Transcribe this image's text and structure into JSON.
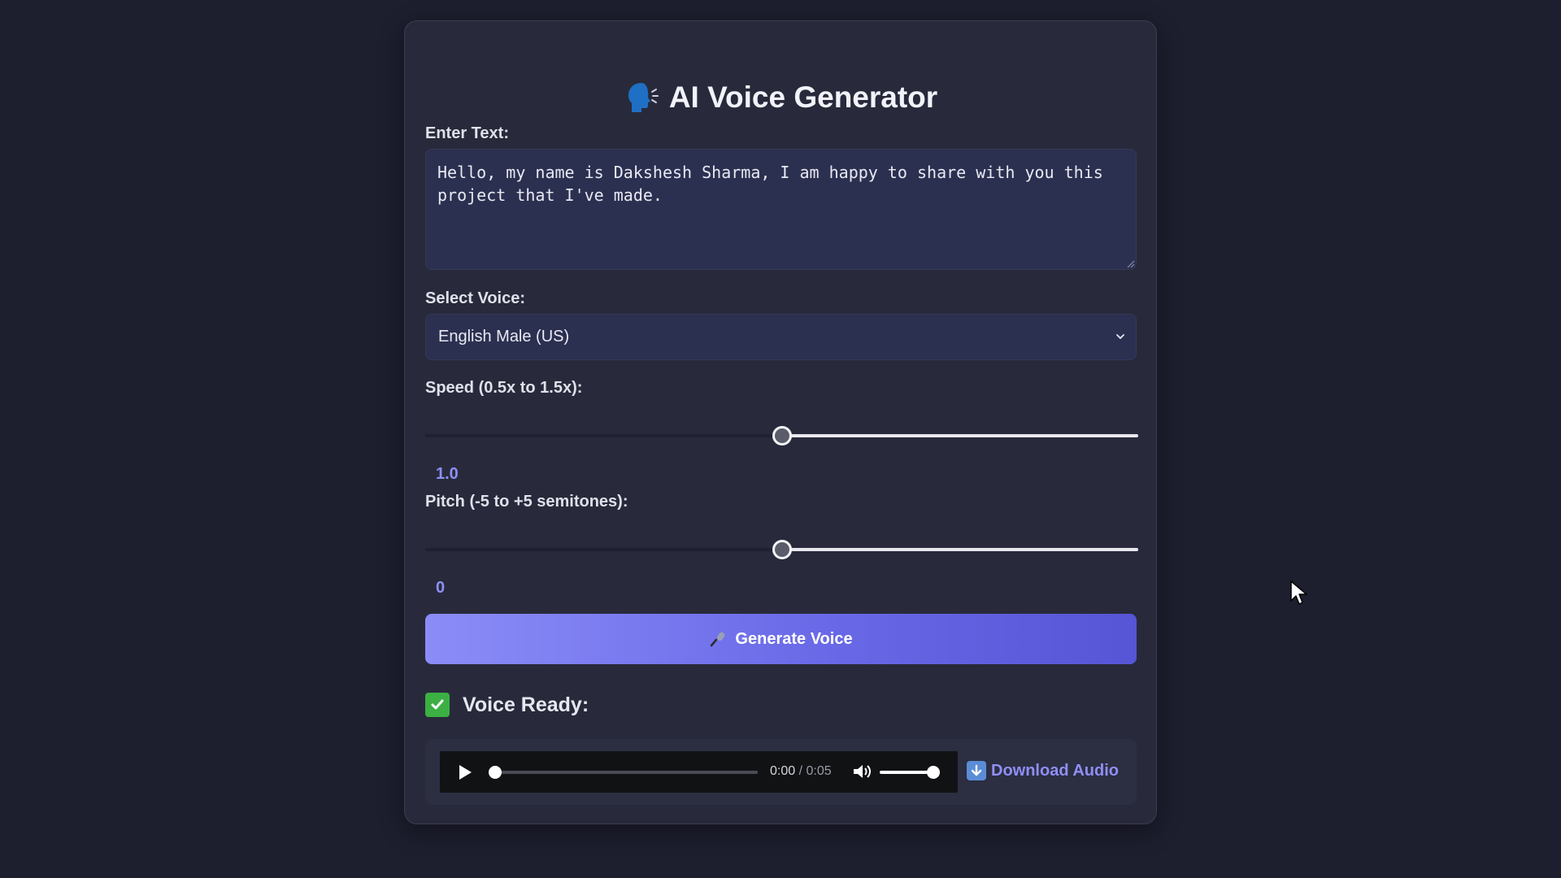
{
  "header": {
    "title": "AI Voice Generator",
    "icon": "speaking-head-icon"
  },
  "text_input": {
    "label": "Enter Text:",
    "value": "Hello, my name is Dakshesh Sharma, I am happy to share with you this project that I've made."
  },
  "voice": {
    "label": "Select Voice:",
    "selected": "English Male (US)"
  },
  "speed": {
    "label": "Speed (0.5x to 1.5x):",
    "min": 0.5,
    "max": 1.5,
    "value": 1.0,
    "value_text": "1.0"
  },
  "pitch": {
    "label": "Pitch (-5 to +5 semitones):",
    "min": -5,
    "max": 5,
    "value": 0,
    "value_text": "0"
  },
  "generate_button": {
    "label": "Generate Voice",
    "icon": "microphone-icon"
  },
  "result": {
    "status": "Voice Ready:",
    "status_icon": "check-mark-icon",
    "current_time": "0:00",
    "separator": "/",
    "duration": "0:05",
    "download_label": "Download Audio",
    "download_icon": "down-arrow-icon"
  },
  "colors": {
    "background": "#1d1e2e",
    "card": "#282a3b",
    "input": "#2c3050",
    "accent": "#8f8ff5",
    "button_start": "#8b8cf7",
    "button_end": "#5555d6",
    "success": "#3cb043"
  }
}
